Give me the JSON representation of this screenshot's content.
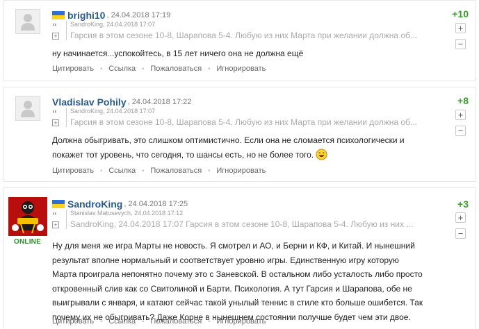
{
  "comments": [
    {
      "author": "brighi10",
      "date": "24.04.2018 17:19",
      "score": "+10",
      "quote_author": "SandroKing",
      "quote_date": "24.04.2018 17:07",
      "quote_text": "Гарсия в этом сезоне 10-8, Шарапова 5-4. Любую из них Марта при желании должна об...",
      "text": "ну начинается...успокойтесь, в 15 лет ничего она не должна ещё",
      "flag": "ukraine"
    },
    {
      "author": "Vladislav Pohily",
      "date": "24.04.2018 17:22",
      "score": "+8",
      "quote_author": "SandroKing",
      "quote_date": "24.04.2018 17:07",
      "quote_text": "Гарсия в этом сезоне 10-8, Шарапова 5-4. Любую из них Марта при желании должна об...",
      "text_lines": [
        "Должна обыгривать, это слишком оптимистично. Если она не сломается психологически и",
        "покажет тот уровень, что сегодня, то шансы есть, но не более того."
      ],
      "smile_icon": "laughing-smiley-icon"
    },
    {
      "author": "SandroKing",
      "date": "24.04.2018 17:25",
      "score": "+3",
      "online": "ONLINE",
      "quote_author": "Stanislav Matusevych",
      "quote_date": "24.04.2018 17:12",
      "quote_text": "SandroKing, 24.04.2018 17:07 Гарсия в этом сезоне 10-8, Шарапова 5-4. Любую из них ...",
      "text_lines": [
        "Ну для меня же игра Марты не новость. Я смотрел и АО, и Берни и КФ, и Китай. И нынешний",
        "результат вполне нормальный и соответствует уровню игры. Единственную игру которую",
        "Марта проиграла непонятно почему это с Заневской. В остальном либо усталость либо просто",
        "откровенный слив как со Свитолиной и Барти. Психология. А тут Гарсия и Шарапова, обе не",
        "выигрывали с января, и катают сейчас такой унылый теннис в стиле кто больше ошибется. Так",
        "почему их не обыгривать? Даже Корне в нынешнем состоянии получше будет чем эти двое."
      ],
      "flag": "ukraine"
    }
  ],
  "actions": {
    "quote": "Цитировать",
    "link": "Ссылка",
    "report": "Пожаловаться",
    "ignore": "Игнорировать"
  },
  "vote": {
    "plus": "+",
    "minus": "−"
  },
  "quote_mark": "“",
  "quote_expand": "+",
  "colors": {
    "score": "#3a9a2c",
    "author": "#2a5a8a",
    "online": "#2e8b2e"
  }
}
